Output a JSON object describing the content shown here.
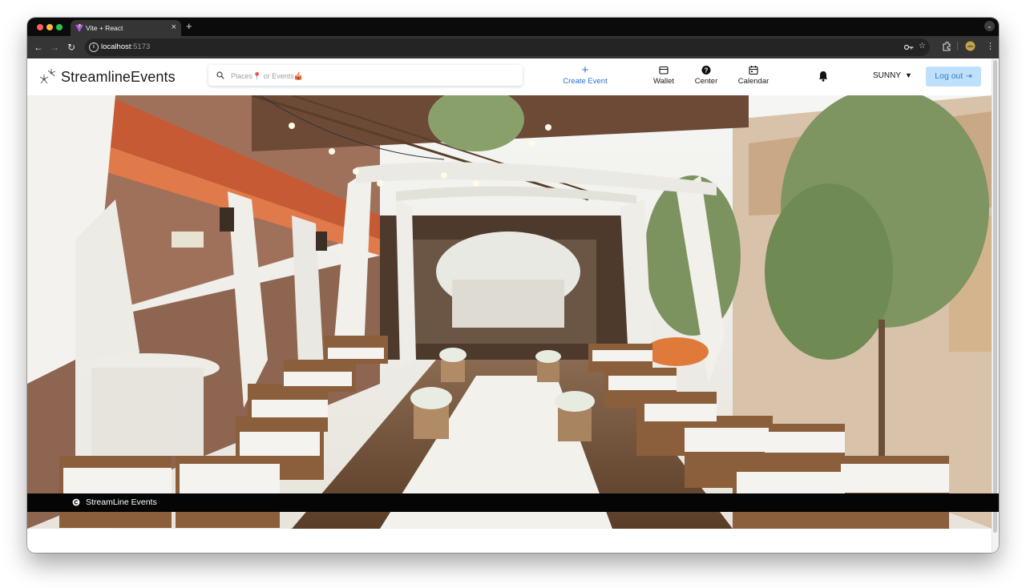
{
  "browser": {
    "tab_title": "Vite + React",
    "url_host": "localhost",
    "url_port": ":5173",
    "icons": [
      "close-icon",
      "new-tab-icon",
      "back-icon",
      "forward-icon",
      "reload-icon",
      "info-icon",
      "key-icon",
      "star-icon",
      "extensions-icon",
      "profile-icon",
      "kebab-menu-icon"
    ]
  },
  "header": {
    "brand": "StreamlineEvents",
    "search_placeholder": "Places📍 or Events🎪",
    "nav": {
      "create_event": "Create Event",
      "wallet": "Wallet",
      "center": "Center",
      "calendar": "Calendar"
    },
    "user_name": "SUNNY",
    "logout_label": "Log out"
  },
  "hero": {
    "description_icon": "hero-image"
  },
  "footer": {
    "brand": "StreamLine Events"
  },
  "colors": {
    "accent": "#2f7dd4",
    "logout_bg": "#bfe0fb",
    "footer_bg": "#050505",
    "browser_chrome": "#353535"
  }
}
